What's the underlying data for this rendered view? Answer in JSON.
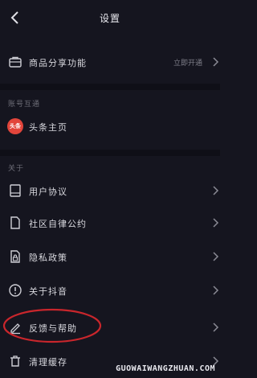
{
  "header": {
    "title": "设置"
  },
  "rows_top": [
    {
      "label": "商品分享功能",
      "value": "立即开通",
      "icon": "briefcase-icon"
    }
  ],
  "section_account": {
    "label": "账号互通"
  },
  "account_rows": [
    {
      "label": "头条主页",
      "badge": "头条",
      "icon": "toutiao-badge-icon"
    }
  ],
  "section_about": {
    "label": "关于"
  },
  "about_rows": [
    {
      "label": "用户协议",
      "icon": "book-icon"
    },
    {
      "label": "社区自律公约",
      "icon": "document-icon"
    },
    {
      "label": "隐私政策",
      "icon": "lock-document-icon"
    },
    {
      "label": "关于抖音",
      "icon": "info-icon"
    },
    {
      "label": "反馈与帮助",
      "icon": "pencil-icon"
    },
    {
      "label": "清理缓存",
      "icon": "trash-icon"
    }
  ],
  "watermark": "GUOWAIWANGZHUAN.COM",
  "colors": {
    "background": "#15151f",
    "annotation": "#c9262c",
    "badge": "#e2453b"
  }
}
